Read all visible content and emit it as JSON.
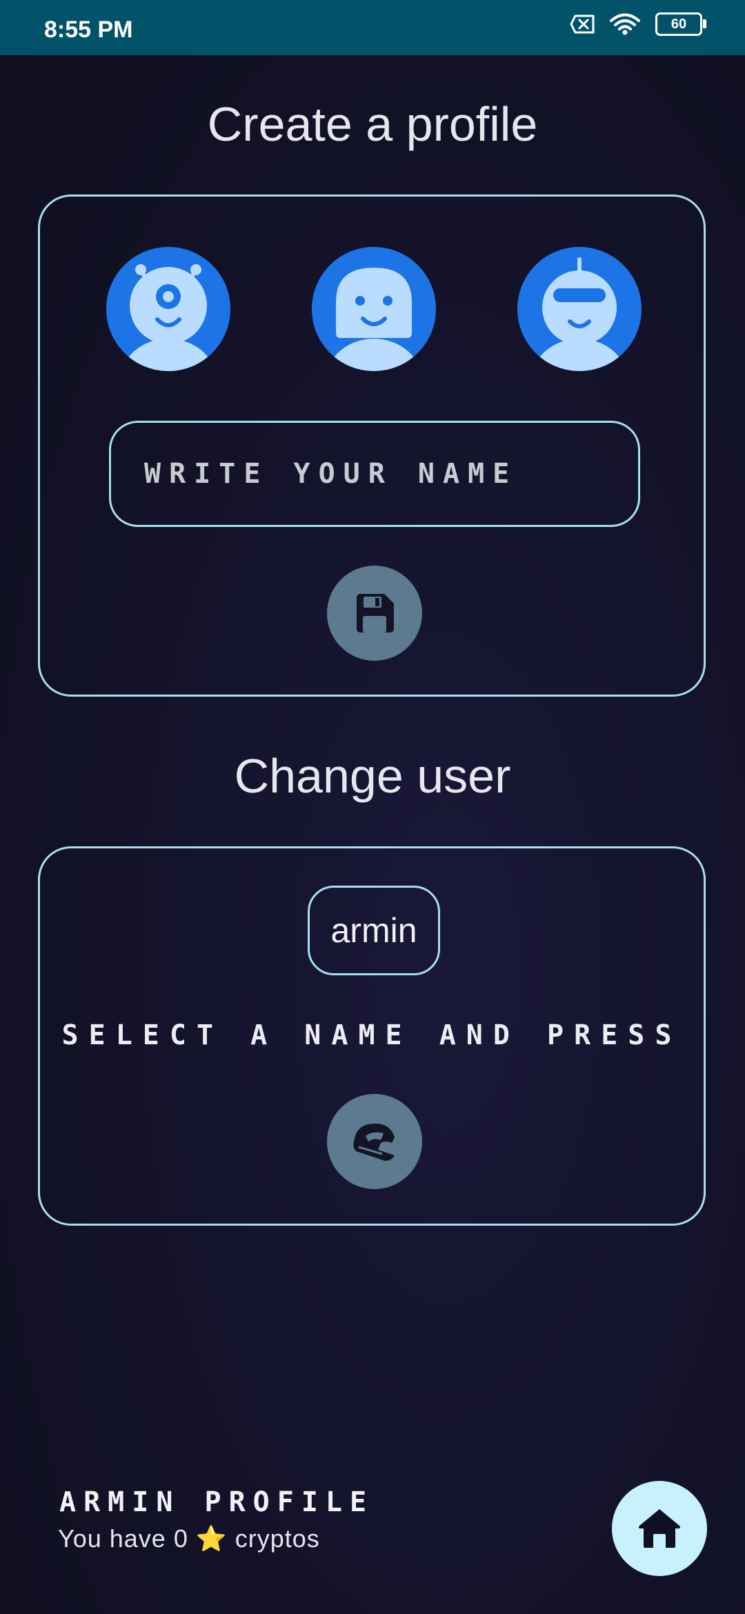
{
  "status_bar": {
    "time": "8:55 PM",
    "battery_level": "60",
    "icons": [
      "sim-off-icon",
      "wifi-icon",
      "battery-icon"
    ]
  },
  "create_profile": {
    "title": "Create a profile",
    "avatars": [
      {
        "name": "alien-avatar"
      },
      {
        "name": "girl-avatar"
      },
      {
        "name": "robot-avatar"
      }
    ],
    "name_placeholder": "WRITE YOUR NAME",
    "save_icon": "floppy-disk-icon"
  },
  "change_user": {
    "title": "Change user",
    "users": [
      "armin"
    ],
    "instruction": "SELECT A NAME AND PRESS",
    "switch_icon": "helmet-icon"
  },
  "footer": {
    "profile_label": "ARMIN PROFILE",
    "crypto_prefix": "You have 0",
    "crypto_star": "⭐",
    "crypto_suffix": "cryptos",
    "home_icon": "home-icon"
  },
  "colors": {
    "status_bar": "#02536a",
    "background": "#131228",
    "card_border": "#a9dff0",
    "avatar_bg": "#1c74e6",
    "avatar_fg": "#b9dcff",
    "button_bg": "#5d7b90",
    "home_button_bg": "#c9f0ff"
  }
}
